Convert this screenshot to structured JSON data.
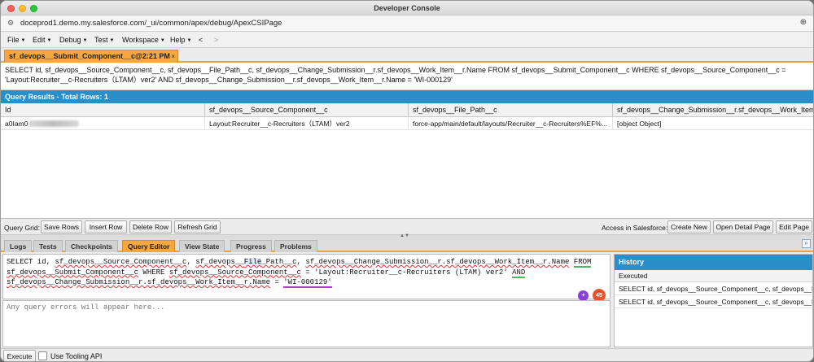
{
  "window": {
    "title": "Developer Console"
  },
  "urlbar": {
    "url": "doceprod1.demo.my.salesforce.com/_ui/common/apex/debug/ApexCSIPage"
  },
  "menu": [
    "File",
    "Edit",
    "Debug",
    "Test",
    "Workspace",
    "Help"
  ],
  "nav": {
    "back": "<",
    "forward": ">"
  },
  "file_tab": {
    "label": "sf_devops__Submit_Component__c@2:21 PM",
    "close": "×"
  },
  "query_text": "SELECT id, sf_devops__Source_Component__c, sf_devops__File_Path__c, sf_devops__Change_Submission__r.sf_devops__Work_Item__r.Name FROM sf_devops__Submit_Component__c WHERE sf_devops__Source_Component__c = 'Layout:Recruiter__c-Recruiters（LTAM）ver2' AND sf_devops__Change_Submission__r.sf_devops__Work_Item__r.Name = 'WI-000129'",
  "results": {
    "header": "Query Results - Total Rows: 1",
    "columns": [
      "Id",
      "sf_devops__Source_Component__c",
      "sf_devops__File_Path__c",
      "sf_devops__Change_Submission__r.sf_devops__Work_Item__r"
    ],
    "rows": [
      {
        "id": "a0Iam0",
        "source_component": "Layout:Recruiter__c-Recruiters（LTAM）ver2",
        "file_path": "force-app/main/default/layouts/Recruiter__c-Recruiters%EF%...",
        "work_item": "[object Object]"
      }
    ]
  },
  "grid_toolbar": {
    "label": "Query Grid:",
    "save_rows": "Save Rows",
    "insert_row": "Insert Row",
    "delete_row": "Delete Row",
    "refresh_grid": "Refresh Grid",
    "access_label": "Access in Salesforce:",
    "create_new": "Create New",
    "open_detail": "Open Detail Page",
    "edit_page": "Edit Page"
  },
  "bottom_tabs": [
    "Logs",
    "Tests",
    "Checkpoints",
    "Query Editor",
    "View State",
    "Progress",
    "Problems"
  ],
  "editor": {
    "line1": {
      "a": "SELECT id, ",
      "b": "sf_devops__Source_Component__c",
      "c": ", ",
      "d": "sf_devops__",
      "e": "File",
      "f": "_Path__c",
      "g": ", ",
      "h": "sf_devops__Change_Submission__r.sf_devops__Work_Item__r.Name",
      "i": " ",
      "j": "FROM"
    },
    "line2": {
      "a": "sf_devops__Submit_Component__c",
      "b": " WHERE ",
      "c": "sf_devops__Source_Component__c",
      "d": " = 'Layout:Recruiter__c-Recruiters (LTAM) ver2' ",
      "e": "AND"
    },
    "line3": {
      "a": "sf_devops__Change_Submission__r.sf_devops__Work_Item__r.Name",
      "b": " = ",
      "c": "'WI-000129'"
    },
    "ai_badge": "✦",
    "count_badge": "45"
  },
  "errors": {
    "placeholder": "Any query errors will appear here..."
  },
  "history": {
    "title": "History",
    "subheader": "Executed",
    "items": [
      "SELECT id, sf_devops__Source_Component__c, sf_devops__F...",
      "SELECT id, sf_devops__Source_Component__c, sf_devops__F..."
    ]
  },
  "footer": {
    "execute": "Execute",
    "tooling_api": "Use Tooling API"
  },
  "colors": {
    "accent_orange": "#f5a742",
    "header_blue": "#2a8ec9"
  },
  "icons": [
    "site-settings-icon",
    "zoom-icon",
    "close-icon",
    "expand-panel-icon",
    "ai-sparkle-icon"
  ]
}
